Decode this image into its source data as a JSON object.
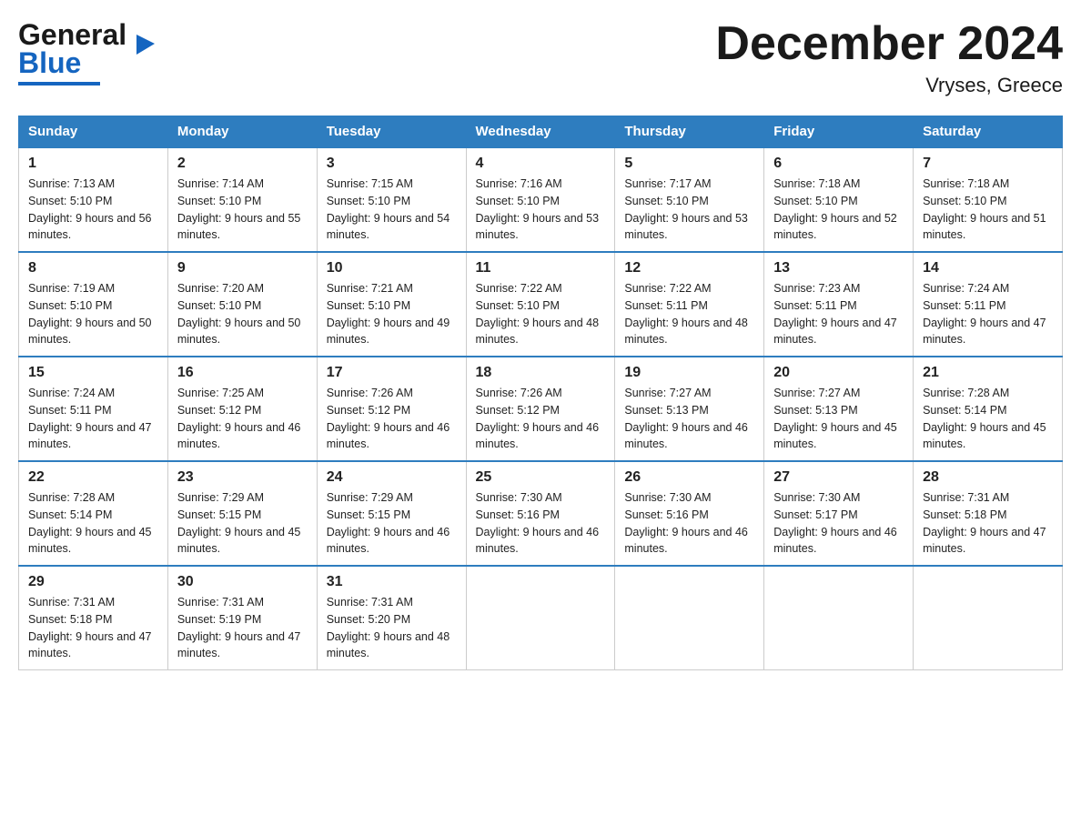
{
  "logo": {
    "general": "General",
    "blue": "Blue"
  },
  "title": {
    "month": "December 2024",
    "location": "Vryses, Greece"
  },
  "weekdays": [
    "Sunday",
    "Monday",
    "Tuesday",
    "Wednesday",
    "Thursday",
    "Friday",
    "Saturday"
  ],
  "weeks": [
    [
      {
        "day": "1",
        "sunrise": "7:13 AM",
        "sunset": "5:10 PM",
        "daylight": "9 hours and 56 minutes."
      },
      {
        "day": "2",
        "sunrise": "7:14 AM",
        "sunset": "5:10 PM",
        "daylight": "9 hours and 55 minutes."
      },
      {
        "day": "3",
        "sunrise": "7:15 AM",
        "sunset": "5:10 PM",
        "daylight": "9 hours and 54 minutes."
      },
      {
        "day": "4",
        "sunrise": "7:16 AM",
        "sunset": "5:10 PM",
        "daylight": "9 hours and 53 minutes."
      },
      {
        "day": "5",
        "sunrise": "7:17 AM",
        "sunset": "5:10 PM",
        "daylight": "9 hours and 53 minutes."
      },
      {
        "day": "6",
        "sunrise": "7:18 AM",
        "sunset": "5:10 PM",
        "daylight": "9 hours and 52 minutes."
      },
      {
        "day": "7",
        "sunrise": "7:18 AM",
        "sunset": "5:10 PM",
        "daylight": "9 hours and 51 minutes."
      }
    ],
    [
      {
        "day": "8",
        "sunrise": "7:19 AM",
        "sunset": "5:10 PM",
        "daylight": "9 hours and 50 minutes."
      },
      {
        "day": "9",
        "sunrise": "7:20 AM",
        "sunset": "5:10 PM",
        "daylight": "9 hours and 50 minutes."
      },
      {
        "day": "10",
        "sunrise": "7:21 AM",
        "sunset": "5:10 PM",
        "daylight": "9 hours and 49 minutes."
      },
      {
        "day": "11",
        "sunrise": "7:22 AM",
        "sunset": "5:10 PM",
        "daylight": "9 hours and 48 minutes."
      },
      {
        "day": "12",
        "sunrise": "7:22 AM",
        "sunset": "5:11 PM",
        "daylight": "9 hours and 48 minutes."
      },
      {
        "day": "13",
        "sunrise": "7:23 AM",
        "sunset": "5:11 PM",
        "daylight": "9 hours and 47 minutes."
      },
      {
        "day": "14",
        "sunrise": "7:24 AM",
        "sunset": "5:11 PM",
        "daylight": "9 hours and 47 minutes."
      }
    ],
    [
      {
        "day": "15",
        "sunrise": "7:24 AM",
        "sunset": "5:11 PM",
        "daylight": "9 hours and 47 minutes."
      },
      {
        "day": "16",
        "sunrise": "7:25 AM",
        "sunset": "5:12 PM",
        "daylight": "9 hours and 46 minutes."
      },
      {
        "day": "17",
        "sunrise": "7:26 AM",
        "sunset": "5:12 PM",
        "daylight": "9 hours and 46 minutes."
      },
      {
        "day": "18",
        "sunrise": "7:26 AM",
        "sunset": "5:12 PM",
        "daylight": "9 hours and 46 minutes."
      },
      {
        "day": "19",
        "sunrise": "7:27 AM",
        "sunset": "5:13 PM",
        "daylight": "9 hours and 46 minutes."
      },
      {
        "day": "20",
        "sunrise": "7:27 AM",
        "sunset": "5:13 PM",
        "daylight": "9 hours and 45 minutes."
      },
      {
        "day": "21",
        "sunrise": "7:28 AM",
        "sunset": "5:14 PM",
        "daylight": "9 hours and 45 minutes."
      }
    ],
    [
      {
        "day": "22",
        "sunrise": "7:28 AM",
        "sunset": "5:14 PM",
        "daylight": "9 hours and 45 minutes."
      },
      {
        "day": "23",
        "sunrise": "7:29 AM",
        "sunset": "5:15 PM",
        "daylight": "9 hours and 45 minutes."
      },
      {
        "day": "24",
        "sunrise": "7:29 AM",
        "sunset": "5:15 PM",
        "daylight": "9 hours and 46 minutes."
      },
      {
        "day": "25",
        "sunrise": "7:30 AM",
        "sunset": "5:16 PM",
        "daylight": "9 hours and 46 minutes."
      },
      {
        "day": "26",
        "sunrise": "7:30 AM",
        "sunset": "5:16 PM",
        "daylight": "9 hours and 46 minutes."
      },
      {
        "day": "27",
        "sunrise": "7:30 AM",
        "sunset": "5:17 PM",
        "daylight": "9 hours and 46 minutes."
      },
      {
        "day": "28",
        "sunrise": "7:31 AM",
        "sunset": "5:18 PM",
        "daylight": "9 hours and 47 minutes."
      }
    ],
    [
      {
        "day": "29",
        "sunrise": "7:31 AM",
        "sunset": "5:18 PM",
        "daylight": "9 hours and 47 minutes."
      },
      {
        "day": "30",
        "sunrise": "7:31 AM",
        "sunset": "5:19 PM",
        "daylight": "9 hours and 47 minutes."
      },
      {
        "day": "31",
        "sunrise": "7:31 AM",
        "sunset": "5:20 PM",
        "daylight": "9 hours and 48 minutes."
      },
      null,
      null,
      null,
      null
    ]
  ]
}
